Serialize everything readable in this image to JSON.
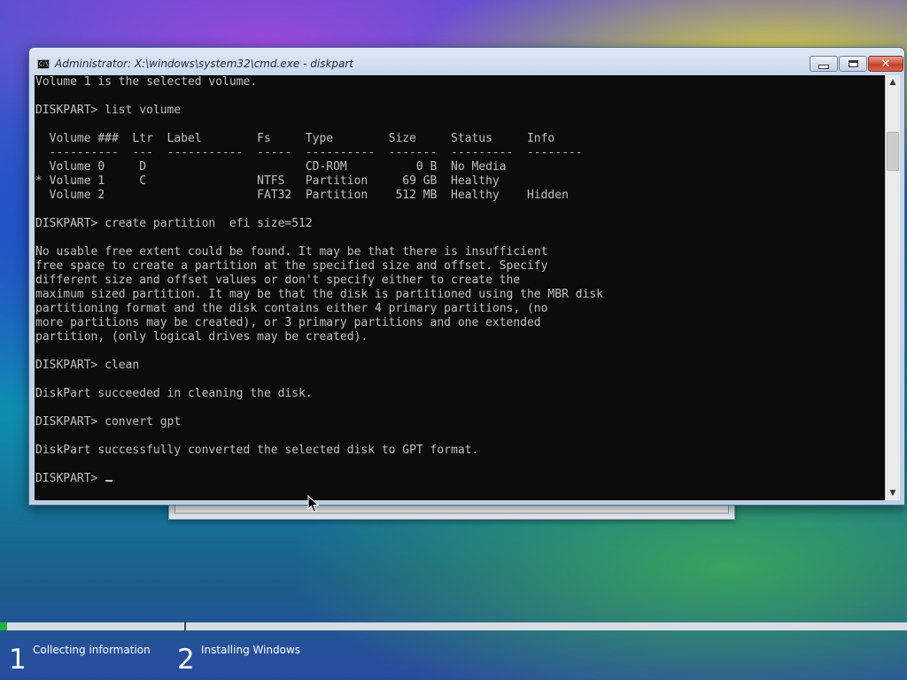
{
  "window": {
    "title": "Administrator: X:\\windows\\system32\\cmd.exe - diskpart",
    "minimize_icon": "minimize-icon",
    "maximize_icon": "maximize-icon",
    "close_label": "✕"
  },
  "console": {
    "lines": [
      "Volume 1 is the selected volume.",
      "",
      "DISKPART> list volume",
      "",
      "  Volume ###  Ltr  Label        Fs     Type        Size     Status     Info",
      "  ----------  ---  -----------  -----  ----------  -------  ---------  --------",
      "  Volume 0     D                       CD-ROM          0 B  No Media",
      "* Volume 1     C                NTFS   Partition     69 GB  Healthy",
      "  Volume 2                      FAT32  Partition    512 MB  Healthy    Hidden",
      "",
      "DISKPART> create partition  efi size=512",
      "",
      "No usable free extent could be found. It may be that there is insufficient",
      "free space to create a partition at the specified size and offset. Specify",
      "different size and offset values or don't specify either to create the",
      "maximum sized partition. It may be that the disk is partitioned using the MBR disk",
      "partitioning format and the disk contains either 4 primary partitions, (no",
      "more partitions may be created), or 3 primary partitions and one extended",
      "partition, (only logical drives may be created).",
      "",
      "DISKPART> clean",
      "",
      "DiskPart succeeded in cleaning the disk.",
      "",
      "DISKPART> convert gpt",
      "",
      "DiskPart successfully converted the selected disk to GPT format.",
      ""
    ],
    "prompt": "DISKPART> "
  },
  "setup": {
    "progress_fraction": 0.008,
    "steps": [
      {
        "number": "1",
        "label": "Collecting information"
      },
      {
        "number": "2",
        "label": "Installing Windows"
      }
    ]
  },
  "colors": {
    "progress": "#1eb43c",
    "console_bg": "#0c0c0c",
    "console_fg": "#c0c0c0"
  }
}
